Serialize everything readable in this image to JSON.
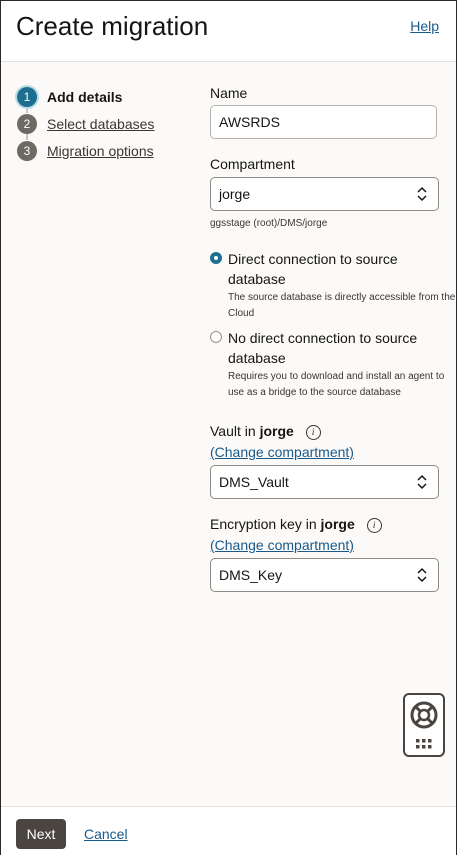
{
  "header": {
    "title": "Create migration",
    "help_label": "Help"
  },
  "steps": [
    {
      "num": "1",
      "label": "Add details"
    },
    {
      "num": "2",
      "label": "Select databases"
    },
    {
      "num": "3",
      "label": "Migration options"
    }
  ],
  "form": {
    "name": {
      "label": "Name",
      "value": "AWSRDS"
    },
    "compartment": {
      "label": "Compartment",
      "value": "jorge",
      "path": "ggsstage (root)/DMS/jorge"
    },
    "connection": {
      "direct": {
        "label": "Direct connection to source database",
        "description": "The source database is directly accessible from the Cloud",
        "selected": true
      },
      "no_direct": {
        "label": "No direct connection to source database",
        "description": "Requires you to download and install an agent to use as a bridge to the source database",
        "selected": false
      }
    },
    "vault": {
      "label_prefix": "Vault in",
      "compartment": "jorge",
      "change_link": "(Change compartment)",
      "value": "DMS_Vault"
    },
    "encryption_key": {
      "label_prefix": "Encryption key in",
      "compartment": "jorge",
      "change_link": "(Change compartment)",
      "value": "DMS_Key"
    }
  },
  "footer": {
    "next_label": "Next",
    "cancel_label": "Cancel"
  },
  "icons": {
    "info": "info-icon",
    "chevron": "chevron-updown-icon",
    "help_widget": "lifebuoy-icon",
    "apps": "grid-icon"
  },
  "colors": {
    "accent": "#1c6f8f",
    "link": "#1a5a8a",
    "button": "#4a4540"
  }
}
